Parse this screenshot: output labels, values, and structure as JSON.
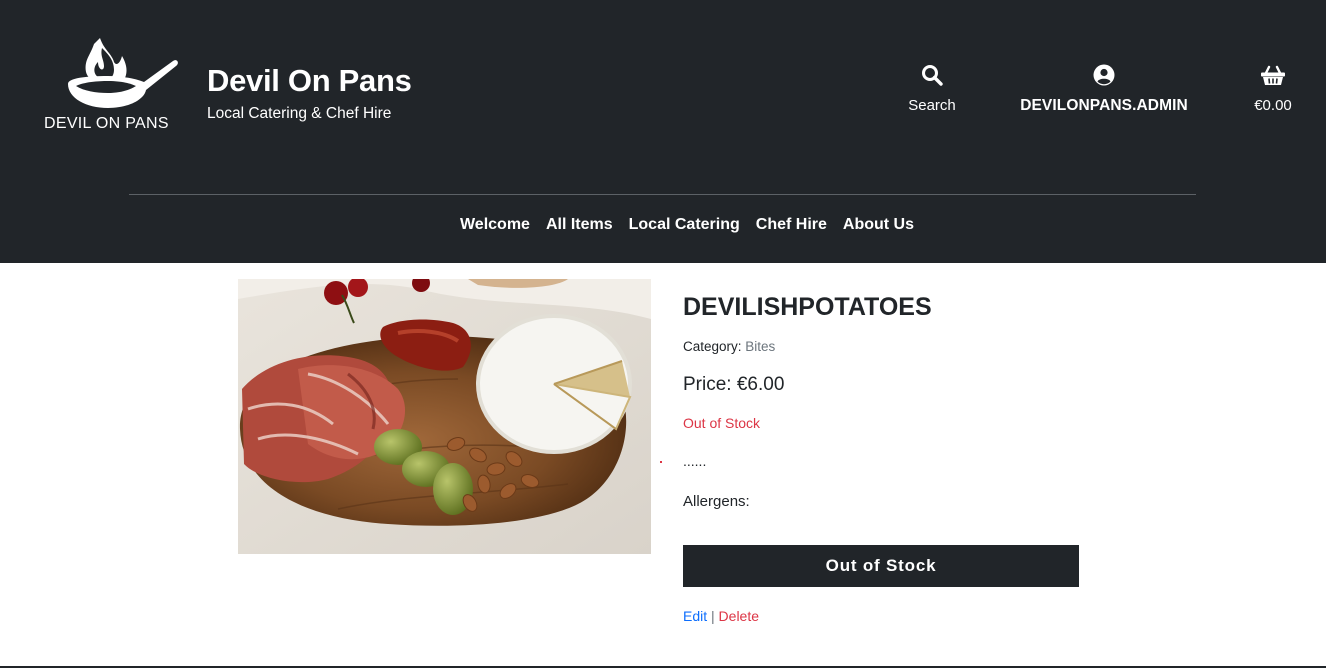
{
  "header": {
    "logo_text": "DEVIL ON PANS",
    "brand_title": "Devil On Pans",
    "brand_tagline": "Local Catering & Chef Hire",
    "actions": {
      "search": {
        "icon": "search-icon",
        "label": "Search"
      },
      "account": {
        "icon": "user-circle-icon",
        "label": "DEVILONPANS.ADMIN"
      },
      "cart": {
        "icon": "basket-icon",
        "label": "€0.00"
      }
    },
    "background_color": "#212529"
  },
  "nav": {
    "items": [
      {
        "label": "Welcome"
      },
      {
        "label": "All Items"
      },
      {
        "label": "Local Catering"
      },
      {
        "label": "Chef Hire"
      },
      {
        "label": "About Us"
      }
    ]
  },
  "product": {
    "name": "DEVILISHPOTATOES",
    "category_label": "Category: ",
    "category_value": "Bites",
    "price": "Price: €6.00",
    "stock_status": "Out of Stock",
    "description": "......",
    "allergens": "Allergens:",
    "button_label": "Out of Stock",
    "image": "charcuterie-board-photo"
  },
  "admin": {
    "edit_label": "Edit",
    "separator": "|",
    "delete_label": "Delete"
  },
  "colors": {
    "dark": "#212529",
    "danger": "#dc3545",
    "link": "#0d6efd",
    "muted": "#6c757d"
  }
}
